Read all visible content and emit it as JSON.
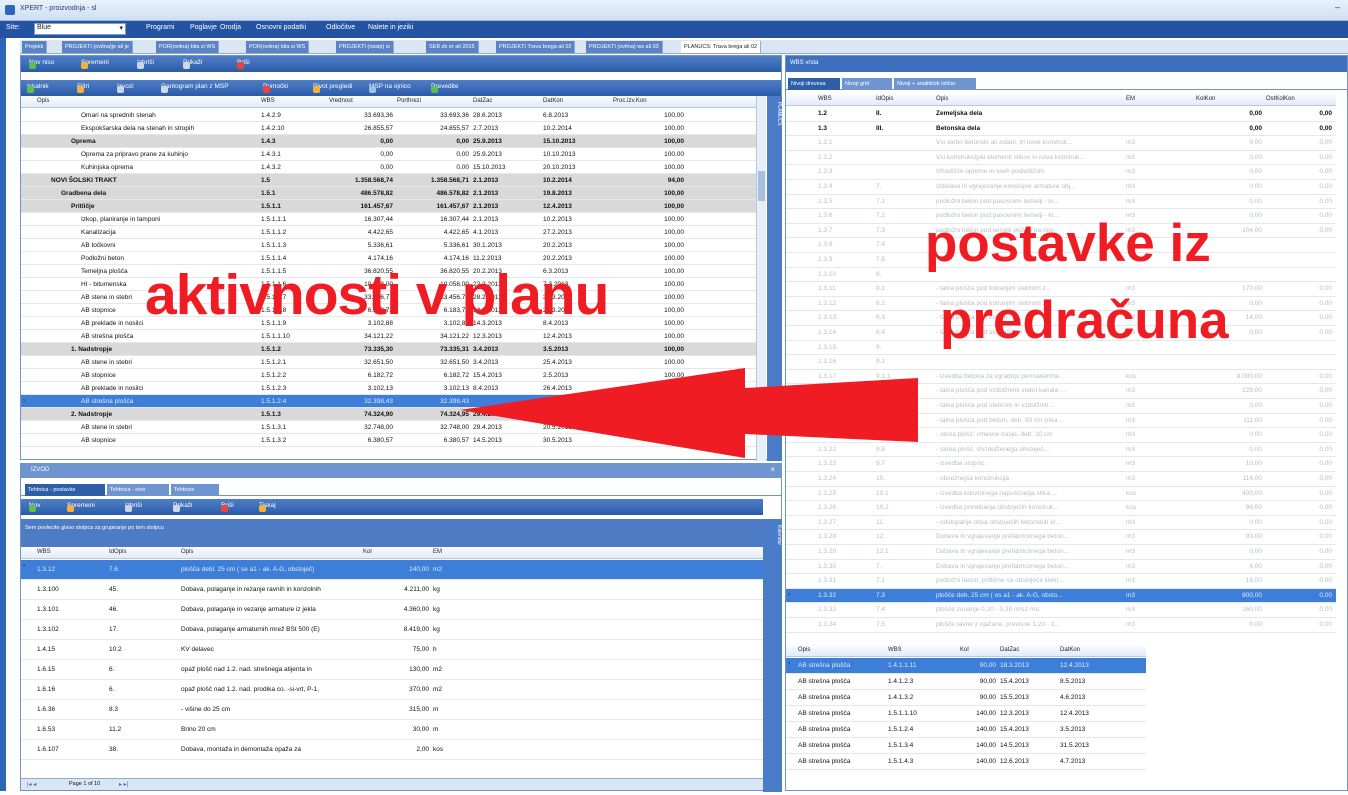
{
  "window": {
    "title": "XPERT - proizvodnja - sl"
  },
  "menu": {
    "site_label": "Site:",
    "site_value": "Blue",
    "items": [
      "Programi",
      "Poglavje",
      "Orodja",
      "Osnovni podatki",
      "Odločitve",
      "Nalete in jeziki"
    ]
  },
  "doc_tabs": [
    "Projekti",
    "PROJEKTI (ovitna)je ali je",
    "POR(ovitna) bila si WS",
    "POR(ovitna) bila si WS",
    "PROJEKTI (nasip) si ",
    "SEB zb er ali 2015",
    "PROJEKTI Trava brega ali 02",
    "PROJEKTI (ovitna) ws ali 03",
    "PLANUCS: Trava brega ali 02"
  ],
  "left": {
    "toolbar1": [
      "Nov niso",
      "Spremeni",
      "Izbriši",
      "Prikaži",
      "Briši"
    ],
    "toolbar2": [
      "Iskalnik",
      "Filtri",
      "Izvozi",
      "Gantogram plan z MSP",
      "Pomočki",
      "Pivot pregledi",
      "MSP na ojnico",
      "Prevedite"
    ],
    "columns": [
      "Opis",
      "WBS",
      "Vrednost",
      "Porthrezi",
      "DatZac",
      "DatKon",
      "Proc.Izv.Kon"
    ],
    "side_label": "PLANUCS",
    "rows": [
      {
        "opis": "Omari na sprednih stenah",
        "wbs": "1.4.2.9",
        "v1": "33.693,36",
        "v2": "33.693,36",
        "d1": "28.6.2013",
        "d2": "6.8.2013",
        "p": "100,00",
        "lvl": 3,
        "g": false
      },
      {
        "opis": "Ekspokšarska dela na stenah in stropih",
        "wbs": "1.4.2.10",
        "v1": "26.855,57",
        "v2": "24.855,57",
        "d1": "2.7.2013",
        "d2": "10.2.2014",
        "p": "100,00",
        "lvl": 3,
        "g": false
      },
      {
        "opis": "Oprema",
        "wbs": "1.4.3",
        "v1": "0,00",
        "v2": "0,00",
        "d1": "25.9.2013",
        "d2": "15.10.2013",
        "p": "100,00",
        "lvl": 2,
        "g": true
      },
      {
        "opis": "Oprema za pripravo prane za kuhinjo",
        "wbs": "1.4.3.1",
        "v1": "0,00",
        "v2": "0,00",
        "d1": "25.9.2013",
        "d2": "10.10.2013",
        "p": "100,00",
        "lvl": 3,
        "g": false
      },
      {
        "opis": "Kuhinjska oprema",
        "wbs": "1.4.3.2",
        "v1": "0,00",
        "v2": "0,00",
        "d1": "15.10.2013",
        "d2": "20.10.2013",
        "p": "100,00",
        "lvl": 3,
        "g": false
      },
      {
        "opis": "NOVI ŠOLSKI TRAKT",
        "wbs": "1.5",
        "v1": "1.358.568,74",
        "v2": "1.358.568,71",
        "d1": "2.1.2013",
        "d2": "10.2.2014",
        "p": "94,00",
        "lvl": 0,
        "g": true
      },
      {
        "opis": "Gradbena dela",
        "wbs": "1.5.1",
        "v1": "486.578,82",
        "v2": "486.578,82",
        "d1": "2.1.2013",
        "d2": "19.8.2013",
        "p": "100,00",
        "lvl": 1,
        "g": true
      },
      {
        "opis": "Pritličje",
        "wbs": "1.5.1.1",
        "v1": "161.457,67",
        "v2": "161.457,67",
        "d1": "2.1.2013",
        "d2": "12.4.2013",
        "p": "100,00",
        "lvl": 2,
        "g": true
      },
      {
        "opis": "Izkop, planiranje in tamponi",
        "wbs": "1.5.1.1.1",
        "v1": "16.307,44",
        "v2": "16.307,44",
        "d1": "2.1.2013",
        "d2": "10.2.2013",
        "p": "100,00",
        "lvl": 3,
        "g": false
      },
      {
        "opis": "Kanalizacija",
        "wbs": "1.5.1.1.2",
        "v1": "4.422,65",
        "v2": "4.422,65",
        "d1": "4.1.2013",
        "d2": "27.2.2013",
        "p": "100,00",
        "lvl": 3,
        "g": false
      },
      {
        "opis": "AB točkovni",
        "wbs": "1.5.1.1.3",
        "v1": "5.336,61",
        "v2": "5.336,61",
        "d1": "30.1.2013",
        "d2": "20.2.2013",
        "p": "100,00",
        "lvl": 3,
        "g": false
      },
      {
        "opis": "Podložni beton",
        "wbs": "1.5.1.1.4",
        "v1": "4.174,16",
        "v2": "4.174,16",
        "d1": "11.2.2013",
        "d2": "20.2.2013",
        "p": "100,00",
        "lvl": 3,
        "g": false
      },
      {
        "opis": "Temeljna plošča",
        "wbs": "1.5.1.1.5",
        "v1": "36.820,55",
        "v2": "36.820,55",
        "d1": "20.2.2013",
        "d2": "6.3.2013",
        "p": "100,00",
        "lvl": 3,
        "g": false
      },
      {
        "opis": "HI - bitumenska",
        "wbs": "1.5.1.1.6",
        "v1": "10.058,00",
        "v2": "10.058,00",
        "d1": "22.2.2013",
        "d2": "7.3.2013",
        "p": "100,00",
        "lvl": 3,
        "g": false
      },
      {
        "opis": "AB stene in stebri",
        "wbs": "1.5.1.1.7",
        "v1": "33.456,77",
        "v2": "33.456,77",
        "d1": "28.2.2013",
        "d2": "30.3.2013",
        "p": "100,00",
        "lvl": 3,
        "g": false
      },
      {
        "opis": "AB stopnice",
        "wbs": "1.5.1.1.8",
        "v1": "6.183,72",
        "v2": "6.183,72",
        "d1": "14.3.2013",
        "d2": "27.3.2013",
        "p": "100,00",
        "lvl": 3,
        "g": false
      },
      {
        "opis": "AB preklade in nosilci",
        "wbs": "1.5.1.1.9",
        "v1": "3.102,88",
        "v2": "3.102,88",
        "d1": "14.3.2013",
        "d2": "8.4.2013",
        "p": "100,00",
        "lvl": 3,
        "g": false
      },
      {
        "opis": "AB strešna plošča",
        "wbs": "1.5.1.1.10",
        "v1": "34.121,22",
        "v2": "34.121,22",
        "d1": "12.3.2013",
        "d2": "12.4.2013",
        "p": "100,00",
        "lvl": 3,
        "g": false
      },
      {
        "opis": "1. Nadstropje",
        "wbs": "1.5.1.2",
        "v1": "73.335,30",
        "v2": "73.335,31",
        "d1": "3.4.2013",
        "d2": "3.5.2013",
        "p": "100,00",
        "lvl": 2,
        "g": true
      },
      {
        "opis": "AB stene in stebri",
        "wbs": "1.5.1.2.1",
        "v1": "32.651,50",
        "v2": "32.651,50",
        "d1": "3.4.2013",
        "d2": "25.4.2013",
        "p": "100,00",
        "lvl": 3,
        "g": false
      },
      {
        "opis": "AB stopnice",
        "wbs": "1.5.1.2.2",
        "v1": "6.182,72",
        "v2": "6.182,72",
        "d1": "15.4.2013",
        "d2": "2.5.2013",
        "p": "100,00",
        "lvl": 3,
        "g": false
      },
      {
        "opis": "AB preklade in nosilci",
        "wbs": "1.5.1.2.3",
        "v1": "3.102,13",
        "v2": "3.102,13",
        "d1": "8.4.2013",
        "d2": "26.4.2013",
        "p": "100,00",
        "lvl": 3,
        "g": false
      },
      {
        "opis": "AB strešna plošča",
        "wbs": "1.5.1.2.4",
        "v1": "32.398,43",
        "v2": "32.398,43",
        "d1": "",
        "d2": "",
        "p": "",
        "lvl": 3,
        "g": false,
        "sel": true
      },
      {
        "opis": "2. Nadstropje",
        "wbs": "1.5.1.3",
        "v1": "74.324,90",
        "v2": "74.324,95",
        "d1": "29.4.2013",
        "d2": "",
        "p": "",
        "lvl": 2,
        "g": true
      },
      {
        "opis": "AB stene in stebri",
        "wbs": "1.5.1.3.1",
        "v1": "32.748,00",
        "v2": "32.748,00",
        "d1": "29.4.2013",
        "d2": "20.5.2013",
        "p": "",
        "lvl": 3,
        "g": false
      },
      {
        "opis": "AB stopnice",
        "wbs": "1.5.1.3.2",
        "v1": "6.380,57",
        "v2": "6.380,57",
        "d1": "14.5.2013",
        "d2": "30.5.2013",
        "p": "100,00",
        "lvl": 3,
        "g": false
      }
    ]
  },
  "bottom": {
    "title": "IZVOD",
    "tabs": [
      "Tehtnica - postavke",
      "Tehtnica - nivo",
      "Tehtnice"
    ],
    "toolbar": [
      "Nov",
      "Spremeni",
      "Izbriši",
      "Prikaži",
      "Briši",
      "Tiskaj"
    ],
    "group_hint": "Sem povlecite glavo stolpca za grupiranje po tem stolpcu",
    "columns": [
      "WBS",
      "IdOpis",
      "Opis",
      "Kol",
      "EM"
    ],
    "side_label": "Kalendar",
    "pager": "Page 1 of 10",
    "rows": [
      {
        "wbs": "1.3.12",
        "id": "7.6",
        "opis": "plošča debl. 25 cm ( se a1 - ak. A-G, obstoječ)",
        "kol": "140,00",
        "em": "m2",
        "sel": true
      },
      {
        "wbs": "1.3.100",
        "id": "45.",
        "opis": "Dobava, polaganje in rezanje ravnih in konzolnih",
        "kol": "4.211,00",
        "em": "kg"
      },
      {
        "wbs": "1.3.101",
        "id": "46.",
        "opis": "Dobava, polaganje in vezanje armature iz jekla",
        "kol": "4.360,00",
        "em": "kg"
      },
      {
        "wbs": "1.3.102",
        "id": "17.",
        "opis": "Dobava, polaganje armaturnih mrež BSt 500 (E)",
        "kol": "8.419,00",
        "em": "kg"
      },
      {
        "wbs": "1.4.15",
        "id": "10.2",
        "opis": "KV delavec",
        "kol": "75,00",
        "em": "h"
      },
      {
        "wbs": "1.6.15",
        "id": "6.",
        "opis": "opaž plošč nad 1.2. nad. strešnega atijenta in",
        "kol": "130,00",
        "em": "m2"
      },
      {
        "wbs": "1.6.16",
        "id": "6.",
        "opis": "opaž plošč nad 1.2. nad. prodika co. -si-vrt, P-1,",
        "kol": "370,00",
        "em": "m2"
      },
      {
        "wbs": "1.6.36",
        "id": "8.3",
        "opis": "- višine do 25 cm",
        "kol": "315,00",
        "em": "m"
      },
      {
        "wbs": "1.6.53",
        "id": "11.2",
        "opis": "Brino 20 cm",
        "kol": "30,00",
        "em": "m"
      },
      {
        "wbs": "1.6.107",
        "id": "38.",
        "opis": "Dobava, montaža in demontaža opaža za",
        "kol": "2,00",
        "em": "kos"
      }
    ]
  },
  "right": {
    "title": "WBS vrsta",
    "tabs": [
      "Nivoji drevesa",
      "Nivoji grid",
      "Nivoji + analitiček ističar"
    ],
    "columns": [
      "WBS",
      "IdOpis",
      "Opis",
      "EM",
      "KolKon",
      "OstKolKon"
    ],
    "rows": [
      {
        "wbs": "1.2",
        "id": "II.",
        "opis": "Zemeljska dela",
        "em": "",
        "k": "0,00",
        "o": "0,00",
        "b": true
      },
      {
        "wbs": "1.3",
        "id": "III.",
        "opis": "Betonska dela",
        "em": "",
        "k": "0,00",
        "o": "0,00",
        "b": true
      },
      {
        "wbs": "1.3.1",
        "id": "",
        "opis": "Vsi stebri betonski ali zidani, tri nove konstruk...",
        "em": "m3",
        "k": "0,00",
        "o": "0,00"
      },
      {
        "wbs": "1.3.2",
        "id": "",
        "opis": "Vsi konstrukcijski elementi stikov in nova konstruk...",
        "em": "m3",
        "k": "0,00",
        "o": "0,00"
      },
      {
        "wbs": "1.3.3",
        "id": "",
        "opis": "Izhodišče opreme in vseh posledičnih",
        "em": "m3",
        "k": "0,00",
        "o": "0,00"
      },
      {
        "wbs": "1.3.4",
        "id": "7.",
        "opis": "Izdelava in vgrajevanje enoslojne armature obj...",
        "em": "m3",
        "k": "0,00",
        "o": "0,00"
      },
      {
        "wbs": "1.3.5",
        "id": "7.1",
        "opis": "podložni beton pod pasovnimi temelji - kr...",
        "em": "m3",
        "k": "0,00",
        "o": "0,00"
      },
      {
        "wbs": "1.3.6",
        "id": "7.2",
        "opis": "podložni beton pod pasovnimi temelji - kr...",
        "em": "m3",
        "k": "0,00",
        "o": "0,00"
      },
      {
        "wbs": "1.3.7",
        "id": "7.3",
        "opis": "podložni beton pod temelji plošče na nov",
        "em": "m3",
        "k": "104,00",
        "o": "0,00"
      },
      {
        "wbs": "1.3.8",
        "id": "7.4",
        "opis": "",
        "em": "",
        "k": "",
        "o": ""
      },
      {
        "wbs": "1.3.9",
        "id": "7.5",
        "opis": "",
        "em": "",
        "k": "",
        "o": ""
      },
      {
        "wbs": "1.3.10",
        "id": "8.",
        "opis": "",
        "em": "",
        "k": "",
        "o": ""
      },
      {
        "wbs": "1.3.11",
        "id": "8.1",
        "opis": "- talna plošča pod kotranjim stebrom z...",
        "em": "m3",
        "k": "170,00",
        "o": "0,00"
      },
      {
        "wbs": "1.3.12",
        "id": "8.2",
        "opis": "- talna plošča pod kotranjim stebrom z...",
        "em": "m3",
        "k": "0,00",
        "o": "0,00"
      },
      {
        "wbs": "1.3.13",
        "id": "8.3",
        "opis": "- talna plošča pod korom",
        "em": "m3",
        "k": "14,00",
        "o": "0,00"
      },
      {
        "wbs": "1.3.14",
        "id": "8.4",
        "opis": "- talna plošča pod stopniščem",
        "em": "m3",
        "k": "0,00",
        "o": "0,00"
      },
      {
        "wbs": "1.3.15",
        "id": "9.",
        "opis": "",
        "em": "",
        "k": "",
        "o": ""
      },
      {
        "wbs": "1.3.16",
        "id": "9.1",
        "opis": "",
        "em": "",
        "k": "",
        "o": ""
      },
      {
        "wbs": "1.3.17",
        "id": "9.1.1",
        "opis": "- izvedba betona za vgradnjo permanentne...",
        "em": "kos",
        "k": "8.000,00",
        "o": "0,00"
      },
      {
        "wbs": "1.3.18",
        "id": "9.2",
        "opis": "- talna plošča pod vzdolžnimi stebri kanala ...",
        "em": "m3",
        "k": "228,00",
        "o": "0,00"
      },
      {
        "wbs": "1.3.19",
        "id": "9.3",
        "opis": "- talna plošča pod stebrom in vzdolžnih...",
        "em": "m3",
        "k": "0,00",
        "o": "0,00"
      },
      {
        "wbs": "1.3.20",
        "id": "9.4",
        "opis": "- talna plošča pod betoni, deb. 50 cm (nea...",
        "em": "m3",
        "k": "111,00",
        "o": "0,00"
      },
      {
        "wbs": "1.3.21",
        "id": "9.5",
        "opis": "- stena plošč. vmesne trasje, deb. 30 cm",
        "em": "m3",
        "k": "0,00",
        "o": "0,00"
      },
      {
        "wbs": "1.3.22",
        "id": "9.6",
        "opis": "- stena plošč. izvzdolženega obstoječ...",
        "em": "m3",
        "k": "0,00",
        "o": "0,00"
      },
      {
        "wbs": "1.3.23",
        "id": "9.7",
        "opis": "- izvedba stopnic",
        "em": "m3",
        "k": "10,00",
        "o": "0,00"
      },
      {
        "wbs": "1.3.24",
        "id": "10.",
        "opis": "- obsežnejša konstrukcija",
        "em": "m3",
        "k": "114,00",
        "o": "0,00"
      },
      {
        "wbs": "1.3.25",
        "id": "10.1",
        "opis": "- izvedba konzolnega napuščnega stika ...",
        "em": "kos",
        "k": "400,00",
        "o": "0,00"
      },
      {
        "wbs": "1.3.26",
        "id": "10.2",
        "opis": "- izvedba prestikanja obstoječih konstruk...",
        "em": "kos",
        "k": "96,00",
        "o": "0,00"
      },
      {
        "wbs": "1.3.27",
        "id": "11.",
        "opis": "- odstopanje obsa obstoječih betonskih el...",
        "em": "m3",
        "k": "0,00",
        "o": "0,00"
      },
      {
        "wbs": "1.3.28",
        "id": "12.",
        "opis": "Dobava in vgrajevanje prefabricirnega beton...",
        "em": "m3",
        "k": "93,00",
        "o": "0,00"
      },
      {
        "wbs": "1.3.29",
        "id": "12.1",
        "opis": "Dobava in vgrajevanje prefabricirnega beton...",
        "em": "m3",
        "k": "0,00",
        "o": "0,00"
      },
      {
        "wbs": "1.3.30",
        "id": "7.",
        "opis": "Dobava in vgrajevanje prefabricirnega beton...",
        "em": "m3",
        "k": "6,00",
        "o": "0,00"
      },
      {
        "wbs": "1.3.31",
        "id": "7.1",
        "opis": "podložni beton, pritlične na obstoječe kletn...",
        "em": "m3",
        "k": "18,00",
        "o": "0,00"
      },
      {
        "wbs": "1.3.32",
        "id": "7.3",
        "opis": "plošče deb. 25 cm ( os a1 - ak. A-G, obsto...",
        "em": "m3",
        "k": "800,00",
        "o": "0,00",
        "sel": true
      },
      {
        "wbs": "1.3.33",
        "id": "7.4",
        "opis": "plošče zunanje 0,20 - 0,30 m/s2 ma",
        "em": "m3",
        "k": "160,00",
        "o": "0,00"
      },
      {
        "wbs": "1.3.34",
        "id": "7.5",
        "opis": "plošče ravne z ojačane, previsne 1,20 - 1...",
        "em": "m3",
        "k": "0,00",
        "o": "0,00"
      }
    ],
    "lower_columns": [
      "Opis",
      "WBS",
      "Kol",
      "DatZac",
      "DatKon"
    ],
    "lower_rows": [
      {
        "opis": "AB strešna plošča",
        "wbs": "1.4.1.1.11",
        "kol": "90,00",
        "d1": "18.3.2013",
        "d2": "12.4.2013",
        "sel": true
      },
      {
        "opis": "AB strešna plošča",
        "wbs": "1.4.1.2.3",
        "kol": "90,00",
        "d1": "15.4.2013",
        "d2": "8.5.2013"
      },
      {
        "opis": "AB strešna plošča",
        "wbs": "1.4.1.3.2",
        "kol": "90,00",
        "d1": "15.5.2013",
        "d2": "4.6.2013"
      },
      {
        "opis": "AB strešna plošča",
        "wbs": "1.5.1.1.10",
        "kol": "140,00",
        "d1": "12.3.2013",
        "d2": "12.4.2013"
      },
      {
        "opis": "AB strešna plošča",
        "wbs": "1.5.1.2.4",
        "kol": "140,00",
        "d1": "15.4.2013",
        "d2": "3.5.2013"
      },
      {
        "opis": "AB strešna plošča",
        "wbs": "1.5.1.3.4",
        "kol": "140,00",
        "d1": "14.5.2013",
        "d2": "31.5.2013"
      },
      {
        "opis": "AB strešna plošča",
        "wbs": "1.5.1.4.3",
        "kol": "140,00",
        "d1": "12.6.2013",
        "d2": "4.7.2013"
      }
    ]
  },
  "annotations": {
    "left": "aktivnosti v planu",
    "right_line1": "postavke iz",
    "right_line2": "predračuna",
    "color": "#f01c24"
  }
}
